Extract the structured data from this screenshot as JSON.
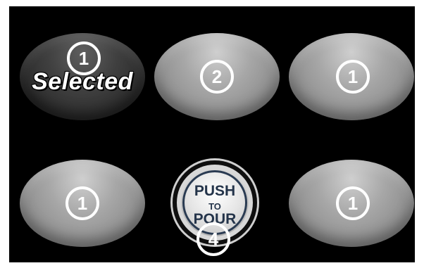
{
  "tiles": [
    {
      "id": "t1",
      "count": "1",
      "selected_label": "Selected"
    },
    {
      "id": "t2",
      "count": "2"
    },
    {
      "id": "t3",
      "count": "1"
    },
    {
      "id": "t4",
      "count": "1"
    },
    {
      "id": "t6",
      "count": "1"
    }
  ],
  "pour_button": {
    "line1": "PUSH",
    "line2": "TO",
    "line3": "POUR",
    "count": "4"
  },
  "colors": {
    "background": "#000000",
    "tile": "#a0a0a0",
    "tile_selected": "#333333",
    "pour_text": "#24344a"
  }
}
